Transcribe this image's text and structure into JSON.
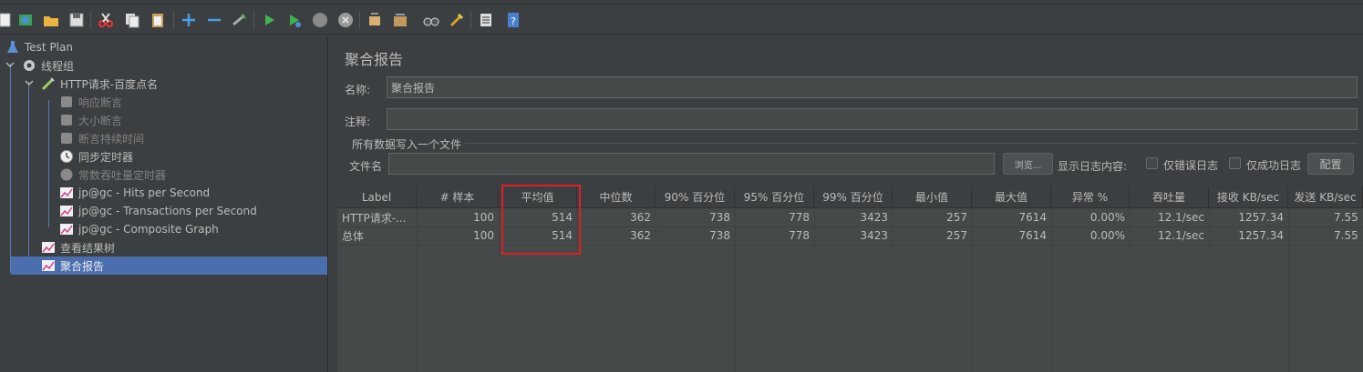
{
  "tree": {
    "items": [
      {
        "label": "Test Plan",
        "icon": "flask-icon"
      },
      {
        "label": "线程组",
        "icon": "gear-icon"
      },
      {
        "label": "HTTP请求-百度点名",
        "icon": "pipette-icon"
      },
      {
        "label": "响应断言",
        "icon": "assertion-icon"
      },
      {
        "label": "大小断言",
        "icon": "assertion-icon"
      },
      {
        "label": "断言持续时间",
        "icon": "assertion-icon"
      },
      {
        "label": "同步定时器",
        "icon": "timer-icon"
      },
      {
        "label": "常数吞吐量定时器",
        "icon": "timer-icon"
      },
      {
        "label": "jp@gc - Hits per Second",
        "icon": "graph-icon"
      },
      {
        "label": "jp@gc - Transactions per Second",
        "icon": "graph-icon"
      },
      {
        "label": "jp@gc - Composite Graph",
        "icon": "graph-icon"
      },
      {
        "label": "查看结果树",
        "icon": "graph-icon"
      },
      {
        "label": "聚合报告",
        "icon": "graph-icon"
      }
    ]
  },
  "panel": {
    "title": "聚合报告",
    "name_label": "名称:",
    "name_value": "聚合报告",
    "comment_label": "注释:",
    "comment_value": "",
    "file_group_label": "所有数据写入一个文件",
    "filename_label": "文件名",
    "filename_value": "",
    "browse_button": "浏览...",
    "log_display_label": "显示日志内容:",
    "errors_only_label": "仅错误日志",
    "success_only_label": "仅成功日志",
    "config_button": "配置"
  },
  "table": {
    "headers": [
      "Label",
      "# 样本",
      "平均值",
      "中位数",
      "90% 百分位",
      "95% 百分位",
      "99% 百分位",
      "最小值",
      "最大值",
      "异常 %",
      "吞吐量",
      "接收 KB/sec",
      "发送 KB/sec"
    ],
    "rows": [
      [
        "HTTP请求-...",
        "100",
        "514",
        "362",
        "738",
        "778",
        "3423",
        "257",
        "7614",
        "0.00%",
        "12.1/sec",
        "1257.34",
        "7.55"
      ],
      [
        "总体",
        "100",
        "514",
        "362",
        "738",
        "778",
        "3423",
        "257",
        "7614",
        "0.00%",
        "12.1/sec",
        "1257.34",
        "7.55"
      ]
    ]
  },
  "colors": {
    "selection": "#4b6eaf",
    "highlight_box": "#e02020"
  }
}
